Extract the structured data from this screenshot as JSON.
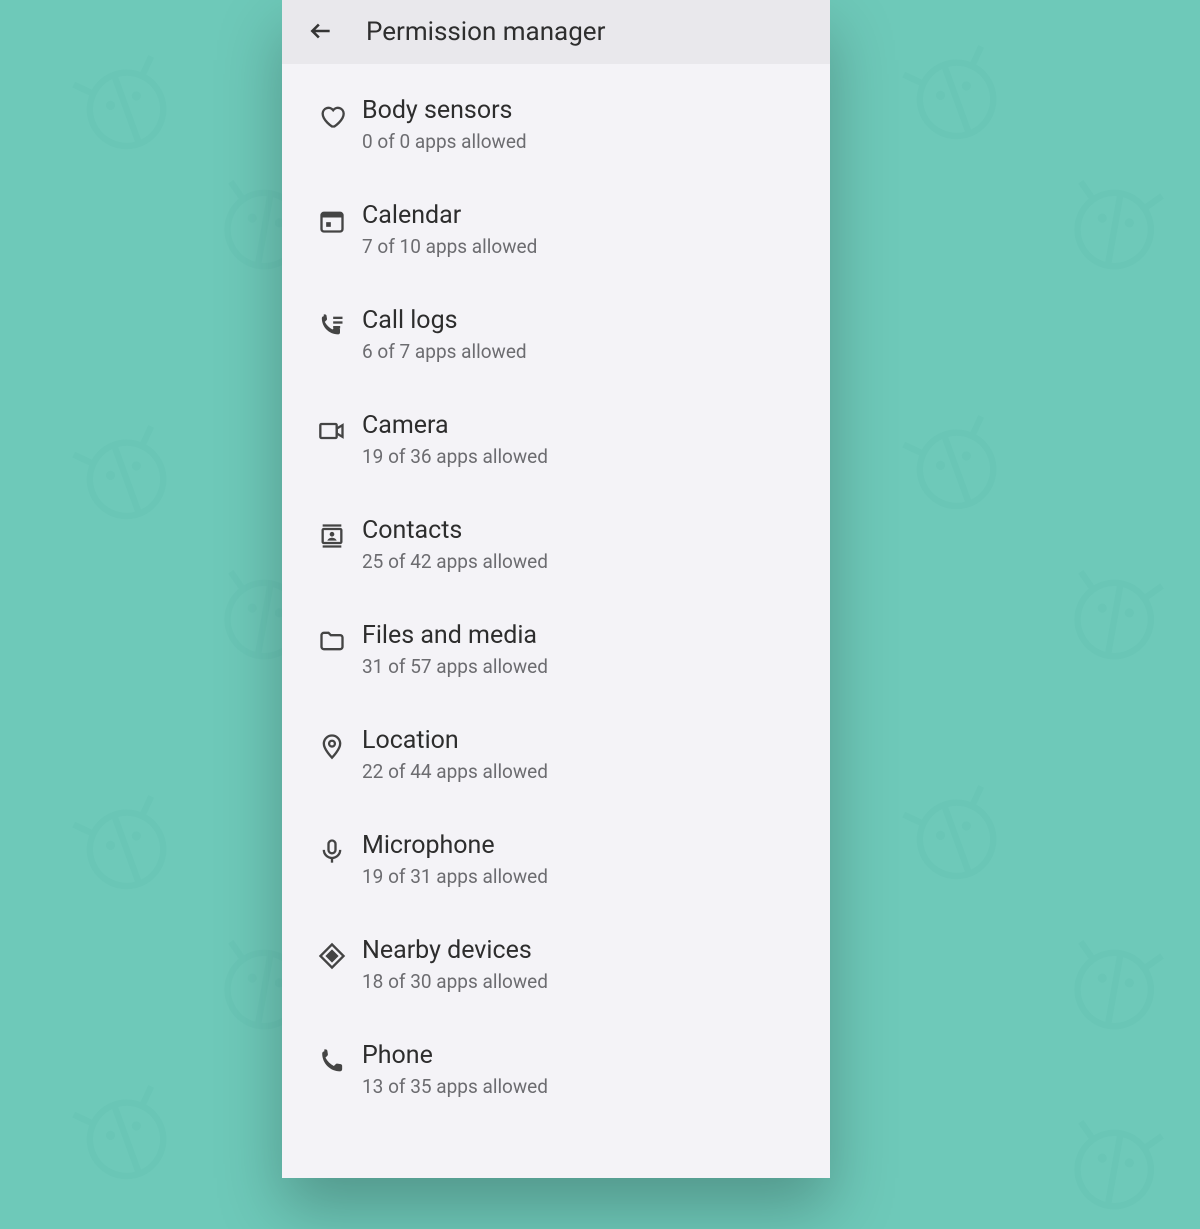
{
  "header": {
    "title": "Permission manager"
  },
  "items": [
    {
      "label": "Body sensors",
      "sub": "0 of 0 apps allowed",
      "icon": "heart-icon",
      "name": "item-body-sensors"
    },
    {
      "label": "Calendar",
      "sub": "7 of 10 apps allowed",
      "icon": "calendar-icon",
      "name": "item-calendar"
    },
    {
      "label": "Call logs",
      "sub": "6 of 7 apps allowed",
      "icon": "call-log-icon",
      "name": "item-call-logs"
    },
    {
      "label": "Camera",
      "sub": "19 of 36 apps allowed",
      "icon": "camera-icon",
      "name": "item-camera"
    },
    {
      "label": "Contacts",
      "sub": "25 of 42 apps allowed",
      "icon": "contacts-icon",
      "name": "item-contacts"
    },
    {
      "label": "Files and media",
      "sub": "31 of 57 apps allowed",
      "icon": "folder-icon",
      "name": "item-files-media"
    },
    {
      "label": "Location",
      "sub": "22 of 44 apps allowed",
      "icon": "location-icon",
      "name": "item-location"
    },
    {
      "label": "Microphone",
      "sub": "19 of 31 apps allowed",
      "icon": "mic-icon",
      "name": "item-microphone"
    },
    {
      "label": "Nearby devices",
      "sub": "18 of 30 apps allowed",
      "icon": "nearby-icon",
      "name": "item-nearby-devices"
    },
    {
      "label": "Phone",
      "sub": "13 of 35 apps allowed",
      "icon": "phone-icon",
      "name": "item-phone"
    }
  ]
}
